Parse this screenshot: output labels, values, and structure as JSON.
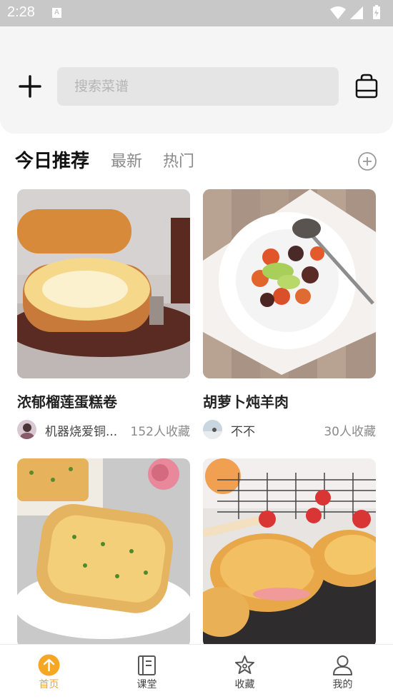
{
  "status_bar": {
    "time": "2:28",
    "notification_icon": "A"
  },
  "header": {
    "add_icon": "plus-icon",
    "search_placeholder": "搜索菜谱",
    "bag_icon": "shopping-bag-icon"
  },
  "tabs": [
    {
      "label": "今日推荐",
      "active": true
    },
    {
      "label": "最新",
      "active": false
    },
    {
      "label": "热门",
      "active": false
    }
  ],
  "recipes": [
    {
      "title": "浓郁榴莲蛋糕卷",
      "author": "机器烧爱铜...",
      "favorites": "152人收藏"
    },
    {
      "title": "胡萝卜炖羊肉",
      "author": "不不",
      "favorites": "30人收藏"
    },
    {
      "title": "",
      "author": "",
      "favorites": ""
    },
    {
      "title": "",
      "author": "",
      "favorites": ""
    }
  ],
  "bottom_nav": [
    {
      "label": "首页",
      "icon": "home-arrow-icon",
      "active": true
    },
    {
      "label": "课堂",
      "icon": "book-icon",
      "active": false
    },
    {
      "label": "收藏",
      "icon": "star-icon",
      "active": false
    },
    {
      "label": "我的",
      "icon": "user-icon",
      "active": false
    }
  ],
  "colors": {
    "accent": "#f5a623",
    "status_bar": "#c8c8c8",
    "header_bg": "#f5f5f5"
  }
}
